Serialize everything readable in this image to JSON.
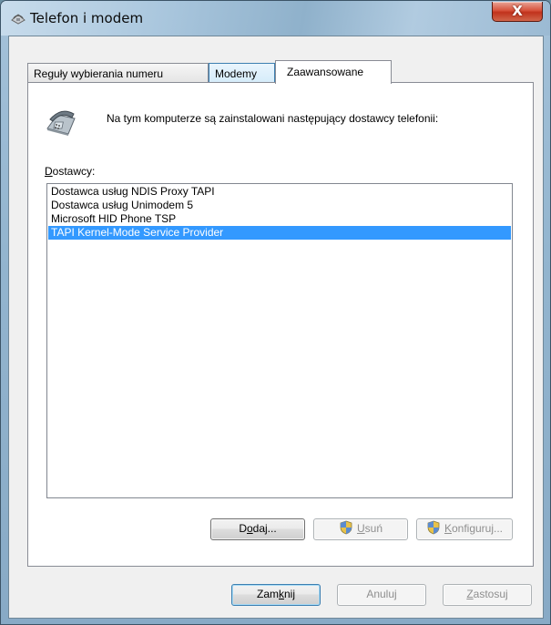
{
  "window": {
    "title": "Telefon i modem",
    "close_label": "X"
  },
  "tabs": [
    {
      "label": "Reguły wybierania numeru",
      "state": "inactive"
    },
    {
      "label": "Modemy",
      "state": "hover"
    },
    {
      "label": "Zaawansowane",
      "state": "active"
    }
  ],
  "panel": {
    "info_text": "Na tym komputerze są zainstalowani następujący dostawcy telefonii:",
    "providers_label_mnemonic": "D",
    "providers_label_rest": "ostawcy:",
    "providers": [
      {
        "label": "Dostawca usług NDIS Proxy TAPI",
        "selected": false
      },
      {
        "label": "Dostawca usług Unimodem 5",
        "selected": false
      },
      {
        "label": "Microsoft HID Phone TSP",
        "selected": false
      },
      {
        "label": "TAPI Kernel-Mode Service Provider",
        "selected": true
      }
    ],
    "buttons": {
      "add": {
        "pre": "D",
        "mn": "o",
        "post": "daj..."
      },
      "remove": {
        "pre": "",
        "mn": "U",
        "post": "suń"
      },
      "configure": {
        "pre": "",
        "mn": "K",
        "post": "onfiguruj..."
      }
    }
  },
  "footer": {
    "close": {
      "pre": "Zam",
      "mn": "k",
      "post": "nij"
    },
    "cancel": "Anuluj",
    "apply": {
      "pre": "",
      "mn": "Z",
      "post": "astosuj"
    }
  },
  "colors": {
    "selection": "#3399ff",
    "close_button": "#c0321c"
  }
}
